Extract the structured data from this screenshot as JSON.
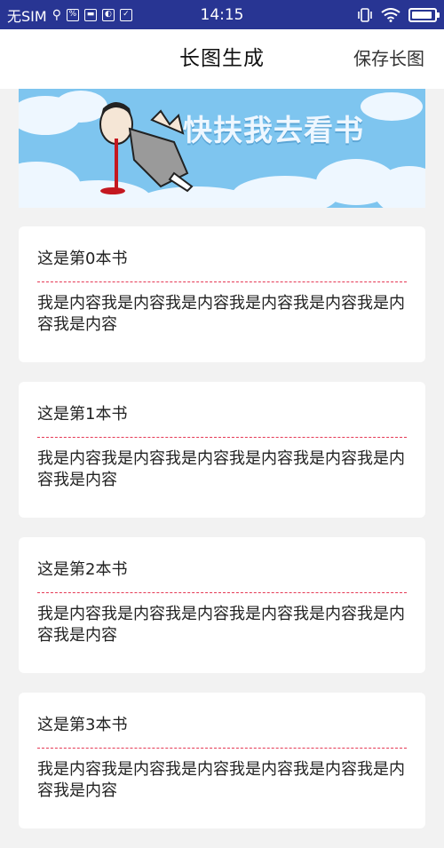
{
  "status_bar": {
    "carrier": "无SIM",
    "time": "14:15",
    "battery_level": 0.9,
    "icons": [
      "usb-icon",
      "app-icon",
      "image-icon",
      "app-icon-2",
      "clipboard-icon",
      "vibrate-icon",
      "wifi-icon",
      "battery-icon"
    ]
  },
  "app_bar": {
    "title": "长图生成",
    "action_label": "保存长图"
  },
  "banner": {
    "text": "快扶我去看书",
    "colors": {
      "sky": "#7ec5ef",
      "cloud": "#eef7ff"
    }
  },
  "cards": [
    {
      "title": "这是第0本书",
      "content": "我是内容我是内容我是内容我是内容我是内容我是内容我是内容"
    },
    {
      "title": "这是第1本书",
      "content": "我是内容我是内容我是内容我是内容我是内容我是内容我是内容"
    },
    {
      "title": "这是第2本书",
      "content": "我是内容我是内容我是内容我是内容我是内容我是内容我是内容"
    },
    {
      "title": "这是第3本书",
      "content": "我是内容我是内容我是内容我是内容我是内容我是内容我是内容"
    }
  ],
  "colors": {
    "status_bar": "#283593",
    "divider": "#e53955",
    "background": "#f2f2f2"
  }
}
